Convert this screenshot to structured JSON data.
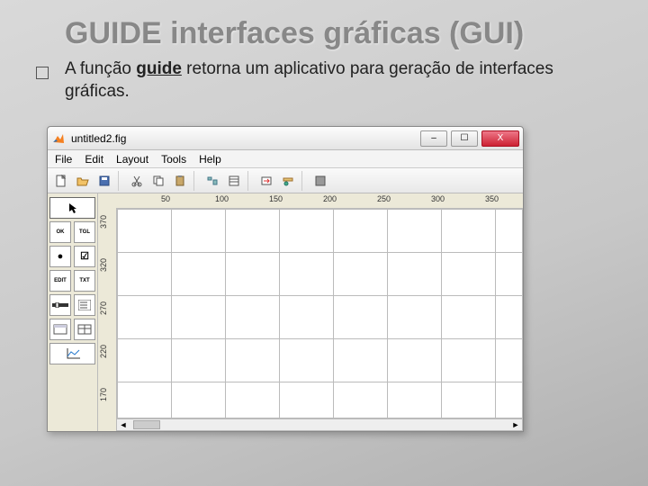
{
  "slide": {
    "title": "GUIDE interfaces gráficas (GUI)",
    "body_pre": "A função ",
    "body_keyword": "guide",
    "body_post": " retorna um aplicativo para geração de interfaces gráficas."
  },
  "window": {
    "title": "untitled2.fig",
    "menus": [
      "File",
      "Edit",
      "Layout",
      "Tools",
      "Help"
    ],
    "toolbar": {
      "new": "new-file",
      "open": "open-file",
      "save": "save-file",
      "cut": "cut",
      "copy": "copy",
      "paste": "paste",
      "align": "align-objects",
      "menu_editor": "menu-editor",
      "tab_editor": "tab-order-editor",
      "toolbar_editor": "toolbar-editor",
      "run": "run-figure"
    },
    "palette": {
      "select": "Select",
      "pushbutton": "OK",
      "togglebutton": "TGL",
      "radio": "●",
      "checkbox": "☑",
      "edit": "EDIT",
      "text": "TXT",
      "slider": "▬▬",
      "listbox": "≡",
      "panel": "▭",
      "axes": "axes"
    },
    "ruler_top": [
      "50",
      "100",
      "150",
      "200",
      "250",
      "300",
      "350"
    ],
    "ruler_left": [
      "370",
      "320",
      "270",
      "220",
      "170"
    ],
    "win_controls": {
      "min": "–",
      "max": "☐",
      "close": "X"
    }
  }
}
